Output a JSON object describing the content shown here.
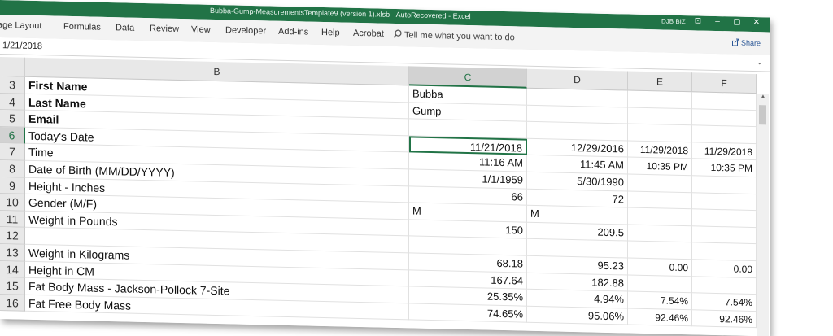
{
  "window": {
    "title": "Bubba-Gump-MeasurementsTemplate9 (version 1).xlsb  -  AutoRecovered  -  Excel",
    "account": "DJB BIZ",
    "controls": [
      "⊡",
      "–",
      "▢",
      "✕"
    ]
  },
  "ribbon": {
    "tabs": [
      "age Layout",
      "Formulas",
      "Data",
      "Review",
      "View",
      "Developer",
      "Add-ins",
      "Help",
      "Acrobat"
    ],
    "tell_me": "Tell me what you want to do",
    "share": "Share"
  },
  "formula_bar": {
    "value": "1/21/2018"
  },
  "sheet": {
    "columns": [
      "B",
      "C",
      "D",
      "E",
      "F"
    ],
    "selected_column": "C",
    "selected_row": "6",
    "rows": [
      {
        "n": "3",
        "label": "First Name",
        "bold": true,
        "C": "Bubba",
        "D": "",
        "E": "",
        "F": ""
      },
      {
        "n": "4",
        "label": "Last Name",
        "bold": true,
        "C": "Gump",
        "D": "",
        "E": "",
        "F": ""
      },
      {
        "n": "5",
        "label": "Email",
        "bold": true,
        "C": "",
        "D": "",
        "E": "",
        "F": ""
      },
      {
        "n": "6",
        "label": "Today's Date",
        "bold": false,
        "C": "11/21/2018",
        "D": "12/29/2016",
        "E": "11/29/2018",
        "F": "11/29/2018"
      },
      {
        "n": "7",
        "label": "Time",
        "bold": false,
        "C": "11:16 AM",
        "D": "11:45 AM",
        "E": "10:35 PM",
        "F": "10:35 PM"
      },
      {
        "n": "8",
        "label": "Date of Birth  (MM/DD/YYYY)",
        "bold": false,
        "C": "1/1/1959",
        "D": "5/30/1990",
        "E": "",
        "F": ""
      },
      {
        "n": "9",
        "label": "Height - Inches",
        "bold": false,
        "C": "66",
        "D": "72",
        "E": "",
        "F": ""
      },
      {
        "n": "10",
        "label": "Gender (M/F)",
        "bold": false,
        "C": "M",
        "D": "M",
        "E": "",
        "F": ""
      },
      {
        "n": "11",
        "label": "Weight in Pounds",
        "bold": false,
        "C": "150",
        "D": "209.5",
        "E": "",
        "F": ""
      },
      {
        "n": "12",
        "label": "",
        "bold": false,
        "C": "",
        "D": "",
        "E": "",
        "F": ""
      },
      {
        "n": "13",
        "label": "Weight in Kilograms",
        "bold": false,
        "C": "68.18",
        "D": "95.23",
        "E": "0.00",
        "F": "0.00"
      },
      {
        "n": "14",
        "label": "Height in CM",
        "bold": false,
        "C": "167.64",
        "D": "182.88",
        "E": "",
        "F": ""
      },
      {
        "n": "15",
        "label": "Fat Body Mass - Jackson-Pollock 7-Site",
        "bold": false,
        "C": "25.35%",
        "D": "4.94%",
        "E": "7.54%",
        "F": "7.54%"
      },
      {
        "n": "16",
        "label": "Fat Free Body Mass",
        "bold": false,
        "C": "74.65%",
        "D": "95.06%",
        "E": "92.46%",
        "F": "92.46%"
      }
    ]
  },
  "colors": {
    "excel_green": "#217346"
  }
}
